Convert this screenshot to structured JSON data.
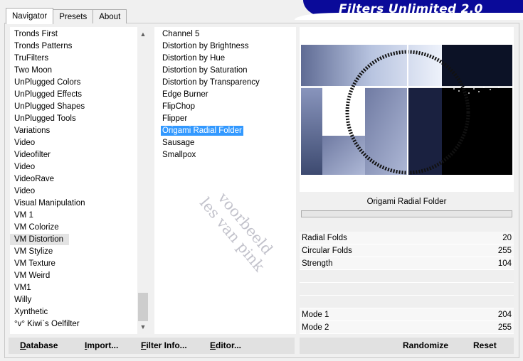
{
  "header": {
    "title": "Filters Unlimited 2.0"
  },
  "tabs": [
    {
      "label": "Navigator",
      "active": true
    },
    {
      "label": "Presets",
      "active": false
    },
    {
      "label": "About",
      "active": false
    }
  ],
  "categories": {
    "items": [
      "Tronds First",
      "Tronds Patterns",
      "TruFilters",
      "Two Moon",
      "UnPlugged Colors",
      "UnPlugged Effects",
      "UnPlugged Shapes",
      "UnPlugged Tools",
      "Variations",
      "Video",
      "Videofilter",
      "Video",
      "VideoRave",
      "Video",
      "Visual Manipulation",
      "VM 1",
      "VM Colorize",
      "VM Distortion",
      "VM Stylize",
      "VM Texture",
      "VM Weird",
      "VM1",
      "Willy",
      "Xynthetic",
      "°v° Kiwi`s Oelfilter"
    ],
    "selected_index": 17
  },
  "filters": {
    "items": [
      "Channel 5",
      "Distortion by Brightness",
      "Distortion by Hue",
      "Distortion by Saturation",
      "Distortion by Transparency",
      "Edge Burner",
      "FlipChop",
      "Flipper",
      "Origami Radial Folder",
      "Sausage",
      "Smallpox"
    ],
    "selected_index": 8
  },
  "watermark": {
    "line1": "voorbeeld",
    "line2": "les van pink"
  },
  "panel": {
    "filter_name": "Origami Radial Folder",
    "params": [
      {
        "label": "Radial Folds",
        "value": "20"
      },
      {
        "label": "Circular Folds",
        "value": "255"
      },
      {
        "label": "Strength",
        "value": "104"
      },
      {
        "label": "",
        "value": ""
      },
      {
        "label": "",
        "value": ""
      },
      {
        "label": "",
        "value": ""
      },
      {
        "label": "Mode 1",
        "value": "204"
      },
      {
        "label": "Mode 2",
        "value": "255"
      }
    ]
  },
  "buttons": {
    "database": {
      "first": "D",
      "rest": "atabase"
    },
    "import": {
      "first": "I",
      "rest": "mport..."
    },
    "filter_info": {
      "first": "F",
      "rest": "ilter Info..."
    },
    "editor": {
      "first": "E",
      "rest": "ditor..."
    },
    "randomize": "Randomize",
    "reset": "Reset"
  },
  "colors": {
    "banner": "#0a0a99",
    "selection": "#3399ff"
  }
}
